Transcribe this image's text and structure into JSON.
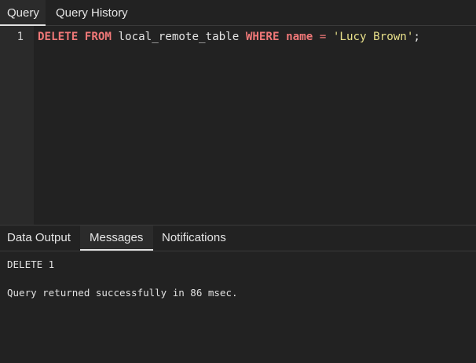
{
  "query_tabs": [
    {
      "label": "Query",
      "active": true
    },
    {
      "label": "Query History",
      "active": false
    }
  ],
  "editor": {
    "line_number": "1",
    "tokens": {
      "kw_delete": "DELETE",
      "kw_from": "FROM",
      "table": "local_remote_table",
      "kw_where": "WHERE",
      "column": "name",
      "operator": "=",
      "value": "'Lucy Brown'",
      "terminator": ";"
    }
  },
  "result_tabs": [
    {
      "label": "Data Output",
      "active": false
    },
    {
      "label": "Messages",
      "active": true
    },
    {
      "label": "Notifications",
      "active": false
    }
  ],
  "messages": [
    "DELETE 1",
    "Query returned successfully in 86 msec."
  ],
  "colors": {
    "background": "#222222",
    "keyword": "#f07878",
    "string": "#e8e08a",
    "text": "#e4e4e4"
  }
}
